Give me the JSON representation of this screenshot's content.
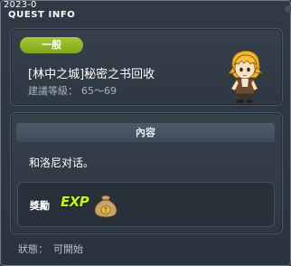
{
  "window": {
    "year_label": "2023-0",
    "title": "QUEST INFO"
  },
  "quest": {
    "category_badge": "一般",
    "name": "[林中之城]秘密之书回收",
    "level_label": "建議等級：",
    "level_range": "65～69",
    "avatar_icon": "npc-character-icon"
  },
  "content": {
    "header": "內容",
    "description": "和洛尼对话。",
    "reward_label": "獎勵",
    "reward_exp_text": "EXP",
    "reward_item_icon": "meso-bag-icon"
  },
  "status": {
    "label": "狀態：",
    "value": "可開始"
  },
  "colors": {
    "badge_green": "#8fb826",
    "exp_green": "#c9ef1f",
    "panel_bg": "#2e3842"
  }
}
